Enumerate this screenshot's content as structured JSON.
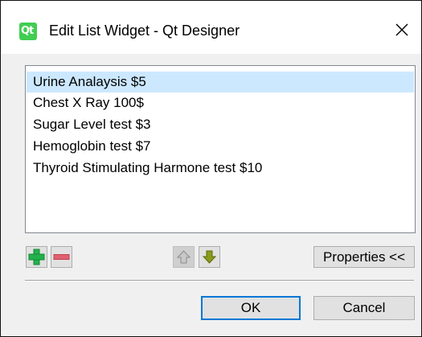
{
  "window": {
    "title": "Edit List Widget - Qt Designer",
    "app_icon_text": "Qt"
  },
  "list": {
    "items": [
      {
        "label": "Urine Analaysis  $5",
        "selected": true
      },
      {
        "label": "Chest X Ray 100$",
        "selected": false
      },
      {
        "label": "Sugar Level test  $3",
        "selected": false
      },
      {
        "label": "Hemoglobin test  $7",
        "selected": false
      },
      {
        "label": "Thyroid Stimulating Harmone test  $10",
        "selected": false
      }
    ]
  },
  "toolbar": {
    "add_icon": "plus-icon",
    "remove_icon": "minus-icon",
    "move_up_icon": "arrow-up-icon",
    "move_down_icon": "arrow-down-icon",
    "properties_label": "Properties <<"
  },
  "buttons": {
    "ok_label": "OK",
    "cancel_label": "Cancel"
  },
  "colors": {
    "selection": "#cce8ff",
    "accent": "#0078d7",
    "add_green": "#22b14c",
    "remove_red": "#e06070",
    "move_down_olive": "#8a9a1a"
  }
}
